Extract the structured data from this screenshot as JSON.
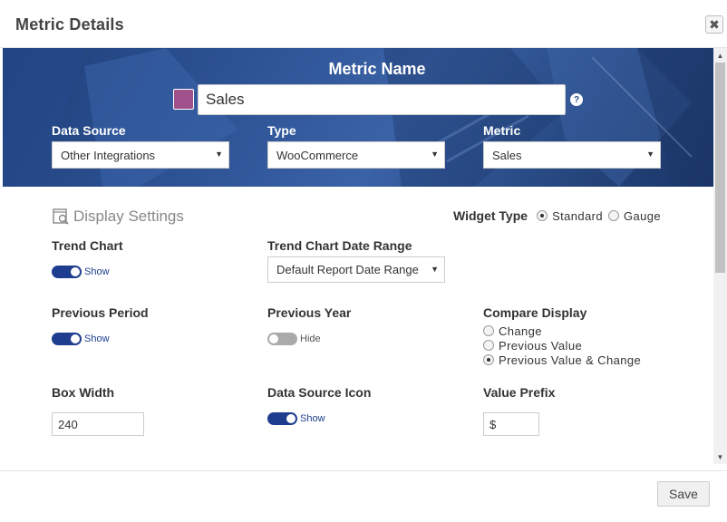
{
  "modal": {
    "title": "Metric Details",
    "close_glyph": "✖"
  },
  "banner": {
    "title": "Metric Name",
    "swatch_color": "#a0508a",
    "name_value": "Sales",
    "help_glyph": "?",
    "data_source": {
      "label": "Data Source",
      "value": "Other Integrations"
    },
    "type": {
      "label": "Type",
      "value": "WooCommerce"
    },
    "metric": {
      "label": "Metric",
      "value": "Sales"
    }
  },
  "display": {
    "title": "Display Settings",
    "widget_type": {
      "label": "Widget Type",
      "options": [
        "Standard",
        "Gauge"
      ],
      "selected": "Standard"
    },
    "trend_chart": {
      "label": "Trend Chart",
      "state": "on",
      "text": "Show"
    },
    "trend_range": {
      "label": "Trend Chart Date Range",
      "value": "Default Report Date Range"
    },
    "previous_period": {
      "label": "Previous Period",
      "state": "on",
      "text": "Show"
    },
    "previous_year": {
      "label": "Previous Year",
      "state": "off",
      "text": "Hide"
    },
    "compare_display": {
      "label": "Compare Display",
      "options": [
        "Change",
        "Previous Value",
        "Previous Value & Change"
      ],
      "selected": "Previous Value & Change"
    },
    "box_width": {
      "label": "Box Width",
      "value": "240"
    },
    "data_source_icon": {
      "label": "Data Source Icon",
      "state": "on",
      "text": "Show"
    },
    "value_prefix": {
      "label": "Value Prefix",
      "value": "$"
    }
  },
  "footer": {
    "save_label": "Save"
  },
  "colors": {
    "banner": "#2f5597",
    "toggle_on": "#1f3d8f",
    "toggle_off": "#aaaaaa"
  },
  "icons": {
    "display_settings": "magnifier-document-icon",
    "dropdown": "caret-down-icon"
  }
}
